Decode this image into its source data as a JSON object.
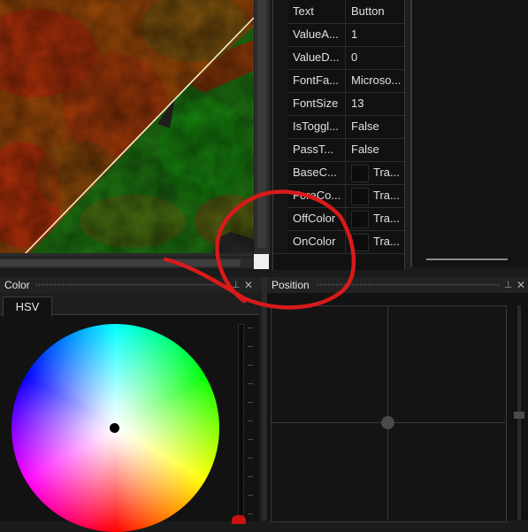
{
  "colors": {
    "accent_red": "#cc1111",
    "annotation_red": "#d81a1a",
    "panel_bg": "#121212",
    "header_bg": "#222222"
  },
  "property_grid": {
    "rows": [
      {
        "name": "Text",
        "value": "Button"
      },
      {
        "name": "ValueA...",
        "value": "1"
      },
      {
        "name": "ValueD...",
        "value": "0"
      },
      {
        "name": "FontFa...",
        "value": "Microso..."
      },
      {
        "name": "FontSize",
        "value": "13"
      },
      {
        "name": "IsToggl...",
        "value": "False"
      },
      {
        "name": "PassT...",
        "value": "False"
      },
      {
        "name": "BaseC...",
        "value": "Tra..."
      },
      {
        "name": "ForeCo...",
        "value": "Tra..."
      },
      {
        "name": "OffColor",
        "value": "Tra..."
      },
      {
        "name": "OnColor",
        "value": "Tra..."
      }
    ]
  },
  "color_panel": {
    "title": "Color",
    "tab_label": "HSV",
    "pin_icon": "pin-icon",
    "close_icon": "close-icon"
  },
  "position_panel": {
    "title": "Position",
    "pin_icon": "pin-icon",
    "close_icon": "close-icon"
  },
  "symbols": {
    "pin": "⊥",
    "close": "✕"
  }
}
